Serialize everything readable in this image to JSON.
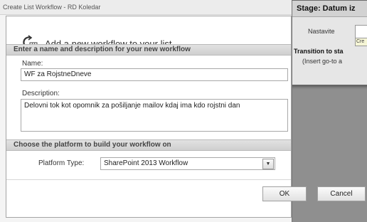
{
  "window": {
    "title": "Create List Workflow - RD Koledar"
  },
  "header": {
    "text": "Add a new workflow to your list",
    "icon": "workflow-add-icon"
  },
  "section_name": {
    "heading": "Enter a name and description for your new workflow",
    "name_label": "Name:",
    "name_value": "WF za RojstneDneve",
    "description_label": "Description:",
    "description_value": "Delovni tok kot opomnik za pošiljanje mailov kdaj ima kdo rojstni dan"
  },
  "section_platform": {
    "heading": "Choose the platform to build your workflow on",
    "platform_label": "Platform Type:",
    "platform_value": "SharePoint 2013 Workflow",
    "dropdown_icon": "chevron-down-icon"
  },
  "buttons": {
    "ok": "OK",
    "cancel": "Cancel"
  },
  "background_panel": {
    "title": "Stage: Datum iz",
    "field_label": "Nastavite",
    "tooltip": "Cre",
    "transition": "Transition to sta",
    "insert_hint": "(Insert go-to a"
  }
}
